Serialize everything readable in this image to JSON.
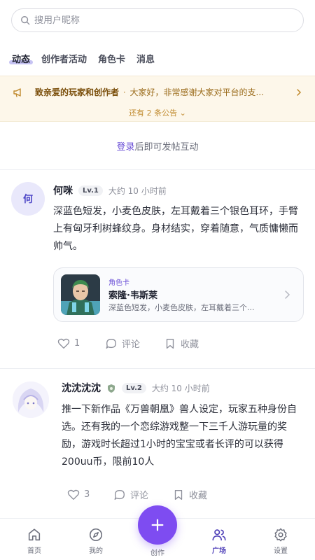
{
  "search": {
    "placeholder": "搜用户昵称"
  },
  "tabs": [
    {
      "label": "动态",
      "active": true
    },
    {
      "label": "创作者活动"
    },
    {
      "label": "角色卡"
    },
    {
      "label": "消息"
    }
  ],
  "notice": {
    "title": "致亲爱的玩家和创作者",
    "separator": "·",
    "text": "大家好，非常感谢大家对平台的支...",
    "more": "还有 2 条公告",
    "more_chevron": "⌄",
    "accent_color": "#c08a2e"
  },
  "login_bar": {
    "link": "登录",
    "text": "后即可发帖互动"
  },
  "posts": [
    {
      "avatar_text": "何",
      "author": "何咪",
      "level": "Lv.1",
      "time": "大约 10 小时前",
      "content": "深蓝色短发，小麦色皮肤，左耳戴着三个银色耳环，手臂上有匈牙利树蜂纹身。身材结实，穿着随意，气质慵懒而帅气。",
      "card": {
        "tag": "角色卡",
        "name": "索隆·韦斯莱",
        "desc": "深蓝色短发，小麦色皮肤，左耳戴着三个..."
      },
      "likes": "1",
      "comment_label": "评论",
      "collect_label": "收藏"
    },
    {
      "author": "沈沈沈沈",
      "level": "Lv.2",
      "time": "大约 10 小时前",
      "content": "推一下新作品《万兽朝凰》兽人设定，玩家五种身份自选。还有我的一个恋综游戏整一下三千人游玩量的奖励，游戏时长超过1小时的宝宝或者长评的可以获得200uu币，限前10人",
      "likes": "3",
      "comment_label": "评论",
      "collect_label": "收藏"
    }
  ],
  "bottom_nav": {
    "items": [
      {
        "label": "首页",
        "icon": "home-icon"
      },
      {
        "label": "我的",
        "icon": "compass-icon"
      },
      {
        "label": "创作",
        "icon": "plus-icon"
      },
      {
        "label": "广场",
        "icon": "users-icon",
        "active": true
      },
      {
        "label": "设置",
        "icon": "gear-icon"
      }
    ],
    "accent_color": "#7e4cf1"
  }
}
